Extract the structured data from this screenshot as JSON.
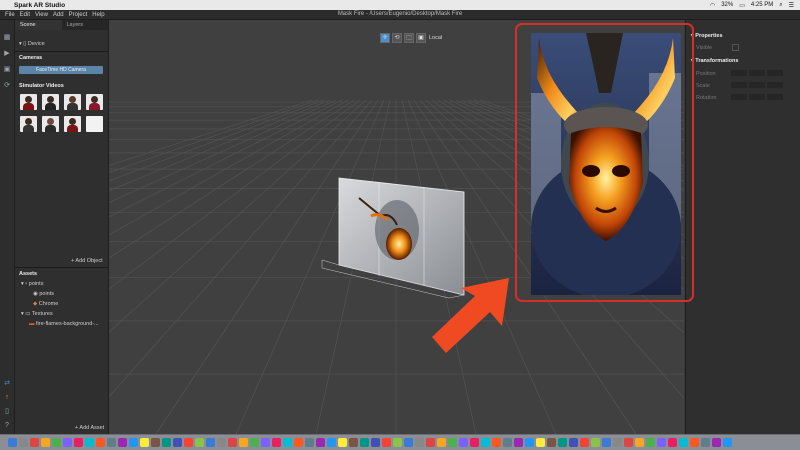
{
  "menubar": {
    "app_name": "Spark AR Studio",
    "status": {
      "battery": "32%",
      "time": "4:25 PM"
    }
  },
  "app_menu": [
    "File",
    "Edit",
    "View",
    "Add",
    "Project",
    "Help"
  ],
  "window_title": "Mask Fire - /Users/Eugenio/Desktop/Mask Fire",
  "scene_panel": {
    "tabs": [
      "Scene",
      "Layers"
    ],
    "device_label": "Device",
    "cameras_header": "Cameras",
    "camera_button": "FaceTime HD Camera",
    "simulator_header": "Simulator Videos",
    "add_object": "+ Add Object"
  },
  "assets_panel": {
    "header": "Assets",
    "items": [
      "points",
      "points",
      "Chrome",
      "Textures",
      "fire-flames-background-..."
    ],
    "add_asset": "+ Add Asset"
  },
  "viewport": {
    "tool_label": "Local"
  },
  "properties_panel": {
    "properties_header": "Properties",
    "visible_label": "Visible",
    "transformations_header": "Transformations",
    "rows": [
      "Position",
      "Scale",
      "Rotation"
    ]
  },
  "colors": {
    "highlight": "#d72f27",
    "arrow": "#f04a22",
    "button": "#5a84a8"
  }
}
